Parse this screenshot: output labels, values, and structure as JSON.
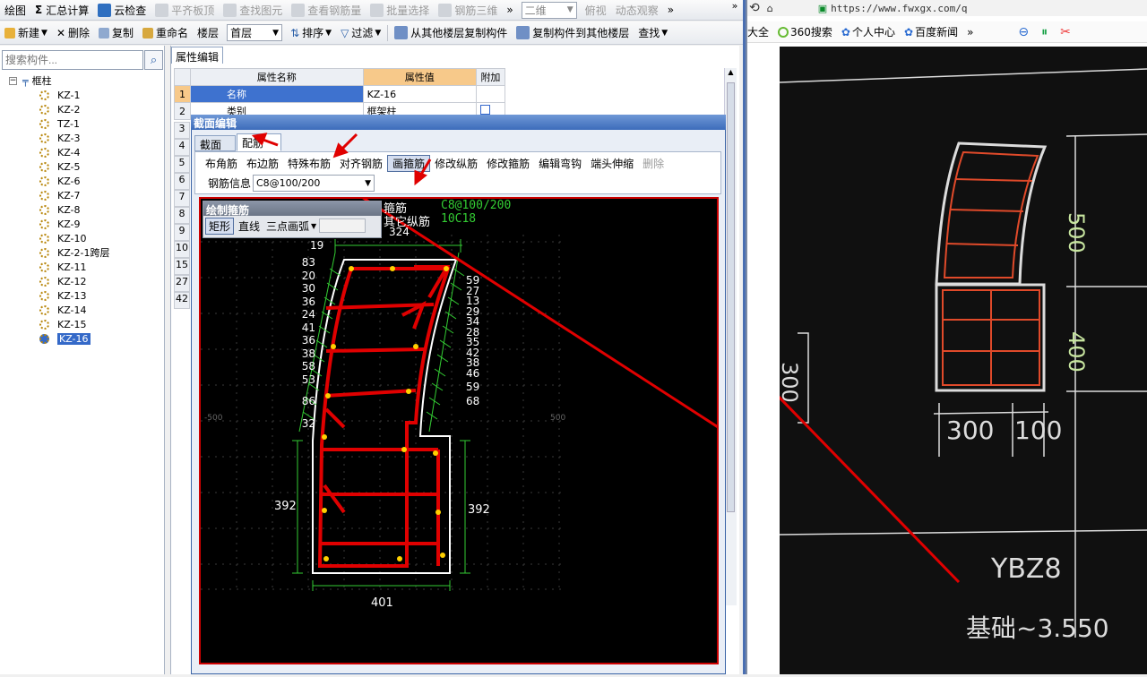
{
  "toolbar1": {
    "items": [
      {
        "label": "绘图",
        "disabled": false
      },
      {
        "label": "汇总计算",
        "disabled": false
      },
      {
        "label": "云检查",
        "disabled": false
      },
      {
        "label": "平齐板顶",
        "disabled": true
      },
      {
        "label": "查找图元",
        "disabled": true
      },
      {
        "label": "查看钢筋量",
        "disabled": true
      },
      {
        "label": "批量选择",
        "disabled": true
      },
      {
        "label": "钢筋三维",
        "disabled": true
      }
    ],
    "view_mode": "二维",
    "view_dir": "俯视",
    "dynamic_view": "动态观察",
    "overflow": "»"
  },
  "toolbar2": {
    "new_label": "新建",
    "delete_label": "删除",
    "copy_label": "复制",
    "rename_label": "重命名",
    "floor_label": "楼层",
    "floor_value": "首层",
    "sort_label": "排序",
    "filter_label": "过滤",
    "copy_from_label": "从其他楼层复制构件",
    "copy_to_label": "复制构件到其他楼层",
    "find_label": "查找"
  },
  "left": {
    "search_placeholder": "搜索构件...",
    "root": "框柱",
    "items": [
      "KZ-1",
      "KZ-2",
      "TZ-1",
      "KZ-3",
      "KZ-4",
      "KZ-5",
      "KZ-6",
      "KZ-7",
      "KZ-8",
      "KZ-9",
      "KZ-10",
      "KZ-2-1跨层",
      "KZ-11",
      "KZ-12",
      "KZ-13",
      "KZ-14",
      "KZ-15",
      "KZ-16"
    ],
    "selected": "KZ-16"
  },
  "props": {
    "tab": "属性编辑",
    "headers": [
      "属性名称",
      "属性值",
      "附加"
    ],
    "rows": [
      {
        "n": "1",
        "name": "名称",
        "value": "KZ-16"
      },
      {
        "n": "2",
        "name": "类别",
        "value": "框架柱"
      }
    ],
    "more_row_numbers": [
      "3",
      "4",
      "5",
      "6",
      "7",
      "8",
      "9",
      "10",
      "15",
      "27",
      "42"
    ]
  },
  "dialog": {
    "title": "截面编辑",
    "tabs": [
      "截面",
      "配筋"
    ],
    "buttons": [
      "布角筋",
      "布边筋",
      "特殊布筋",
      "对齐钢筋",
      "画箍筋",
      "修改纵筋",
      "修改箍筋",
      "编辑弯钩",
      "端头伸缩",
      "删除"
    ],
    "active_button": "画箍筋",
    "rebar_info_label": "钢筋信息",
    "rebar_info_value": "C8@100/200",
    "draw_panel_title": "绘制箍筋",
    "draw_modes": [
      "矩形",
      "直线",
      "三点画弧"
    ],
    "canvas_texts": {
      "stirrup_label": "箍筋",
      "stirrup_value": "C8@100/200",
      "other_label": "其它纵筋",
      "other_value": "10C18",
      "dim_top": "324",
      "dim_19": "19",
      "left_dims": [
        "83",
        "20",
        "30",
        "36",
        "24",
        "41",
        "36",
        "38",
        "58",
        "53",
        "86",
        "32"
      ],
      "right_dims": [
        "59",
        "27",
        "13",
        "29",
        "34",
        "28",
        "35",
        "42",
        "38",
        "46",
        "59",
        "68"
      ],
      "dim_392_left": "392",
      "dim_392_right": "392",
      "dim_bottom": "401",
      "axis_500_l": "-500",
      "axis_500_r": "500"
    }
  },
  "browser": {
    "url": "https://www.fwxgx.com/q",
    "bookmarks": [
      "大全",
      "360搜索",
      "个人中心",
      "百度新闻"
    ],
    "photo_labels": {
      "dim_500": "500",
      "dim_400": "400",
      "dim_300": "300",
      "dim_100": "100",
      "label": "YBZ8",
      "elev": "基础~3.550",
      "left_dim": "300"
    }
  },
  "colors": {
    "accent_red": "#e00000",
    "cad_green": "#33cc33",
    "cad_white": "#ffffff",
    "selection": "#3469c8"
  }
}
